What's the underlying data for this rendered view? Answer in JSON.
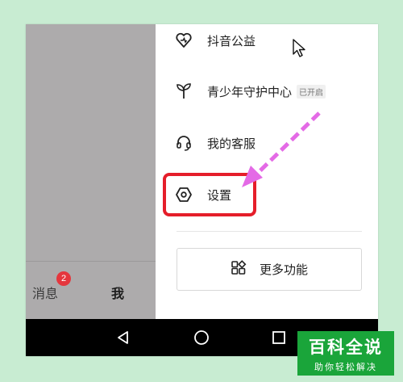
{
  "bottom_tabs": {
    "messages_label": "消息",
    "messages_badge": "2",
    "me_label": "我"
  },
  "drawer": {
    "items": [
      {
        "label": "抖音公益",
        "icon": "heart-charity-icon"
      },
      {
        "label": "青少年守护中心",
        "icon": "sprout-icon",
        "status": "已开启"
      },
      {
        "label": "我的客服",
        "icon": "headset-icon"
      },
      {
        "label": "设置",
        "icon": "settings-hexagon-icon"
      }
    ],
    "more_button": {
      "label": "更多功能",
      "icon": "grid-icon"
    }
  },
  "navbar": {
    "back": "back-triangle-icon",
    "home": "home-circle-icon",
    "recents": "recents-square-icon"
  },
  "watermark": {
    "title": "百科全说",
    "subtitle": "助你轻松解决"
  },
  "colors": {
    "highlight": "#e51e2a",
    "arrow": "#e46ae6",
    "badge": "#e5363d",
    "watermark_bg": "#1aa53a",
    "page_bg": "#c8ecd2"
  }
}
